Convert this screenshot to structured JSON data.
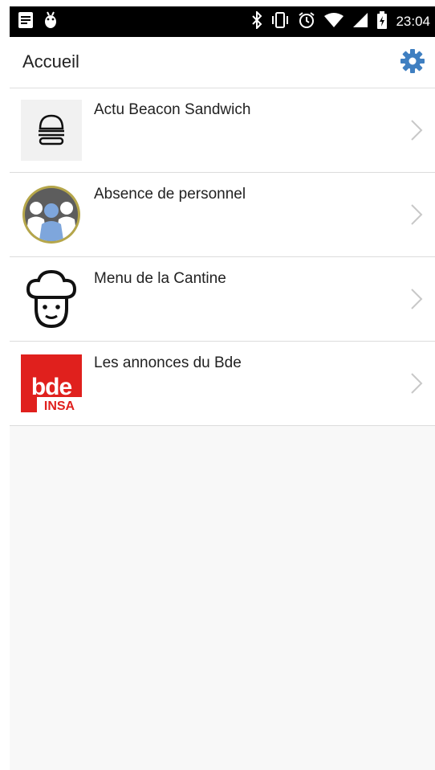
{
  "status_bar": {
    "time": "23:04",
    "icons": [
      "notification-icon",
      "android-debug-icon",
      "bluetooth-icon",
      "vibrate-icon",
      "alarm-icon",
      "wifi-icon",
      "signal-icon",
      "battery-charging-icon"
    ]
  },
  "app_bar": {
    "title": "Accueil",
    "settings_icon": "gear-icon",
    "accent_color": "#3f7fc1"
  },
  "list": {
    "items": [
      {
        "label": "Actu Beacon Sandwich",
        "icon": "burger-icon"
      },
      {
        "label": "Absence de personnel",
        "icon": "staff-group-icon"
      },
      {
        "label": "Menu de la Cantine",
        "icon": "chef-icon"
      },
      {
        "label": "Les annonces du Bde",
        "icon": "bde-insa-logo",
        "logo_text": "bde",
        "logo_subtext": "INSA",
        "logo_color": "#e0201d"
      }
    ]
  }
}
